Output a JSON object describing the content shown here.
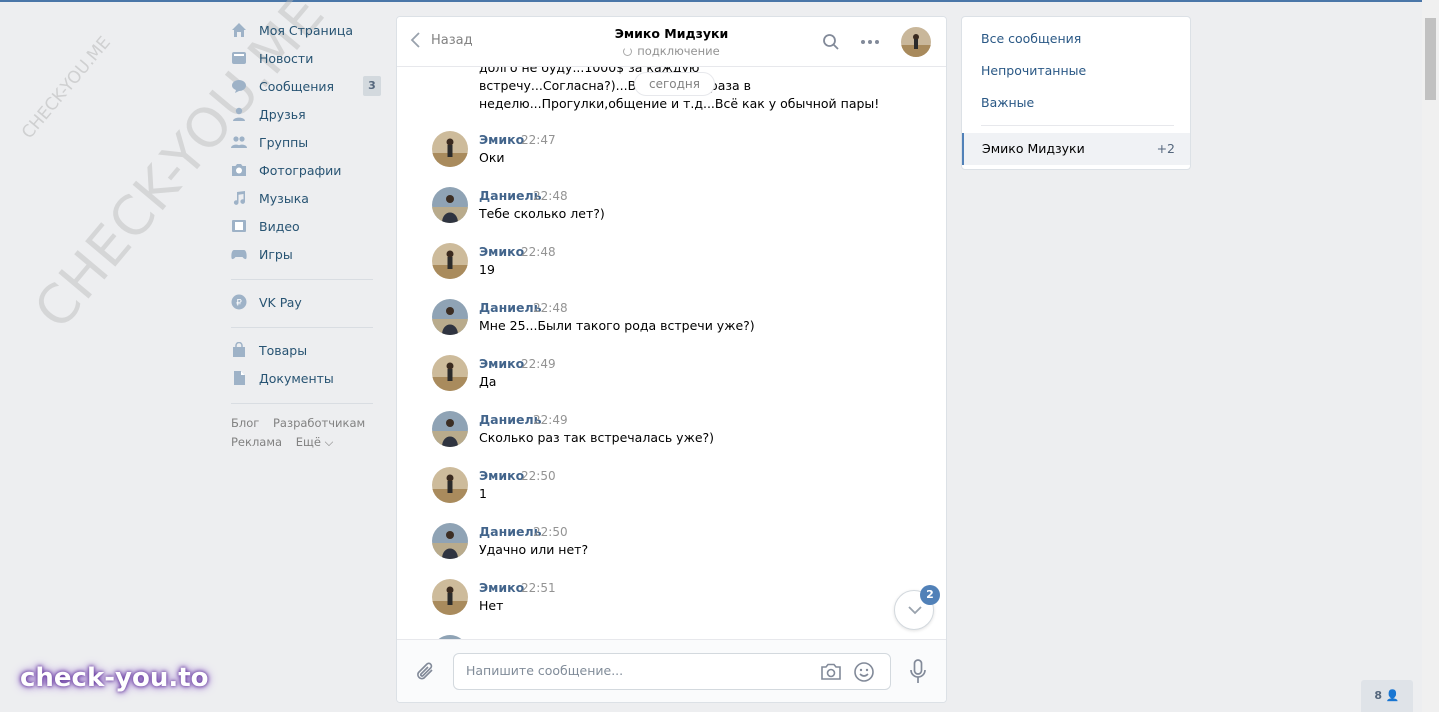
{
  "nav": {
    "items": [
      {
        "label": "Моя Страница",
        "icon": "home-icon"
      },
      {
        "label": "Новости",
        "icon": "news-icon"
      },
      {
        "label": "Сообщения",
        "icon": "messages-icon",
        "badge": "3"
      },
      {
        "label": "Друзья",
        "icon": "friends-icon"
      },
      {
        "label": "Группы",
        "icon": "groups-icon"
      },
      {
        "label": "Фотографии",
        "icon": "photos-icon"
      },
      {
        "label": "Музыка",
        "icon": "music-icon"
      },
      {
        "label": "Видео",
        "icon": "video-icon"
      },
      {
        "label": "Игры",
        "icon": "games-icon"
      },
      {
        "label": "VK Pay",
        "icon": "vkpay-icon"
      },
      {
        "label": "Товары",
        "icon": "market-icon"
      },
      {
        "label": "Документы",
        "icon": "documents-icon"
      }
    ],
    "footer": {
      "blog": "Блог",
      "dev": "Разработчикам",
      "ads": "Реклама",
      "more": "Ещё ⌵"
    }
  },
  "watermarks": {
    "small": "CHECK-YOU.ME",
    "large": "CHECK-YOU.ME",
    "brand": "check-you.to"
  },
  "chat": {
    "back_label": "Назад",
    "title": "Эмико Мидзуки",
    "status": "подключение",
    "date_pill": "сегодня",
    "prev_text": "долго не буду...1000$ за каждую встречу...Согласна?)...Встречи 2-3 раза в неделю...Прогулки,общение и т.д...Всё как у обычной пары!",
    "messages": [
      {
        "author": "Эмико",
        "time": "22:47",
        "text": "Оки"
      },
      {
        "author": "Даниель",
        "time": "22:48",
        "text": "Тебе сколько лет?)"
      },
      {
        "author": "Эмико",
        "time": "22:48",
        "text": "19"
      },
      {
        "author": "Даниель",
        "time": "22:48",
        "text": "Мне 25...Были такого рода встречи уже?)"
      },
      {
        "author": "Эмико",
        "time": "22:49",
        "text": "Да"
      },
      {
        "author": "Даниель",
        "time": "22:49",
        "text": "Сколько раз так встречалась уже?)"
      },
      {
        "author": "Эмико",
        "time": "22:50",
        "text": "1"
      },
      {
        "author": "Даниель",
        "time": "22:50",
        "text": "Удачно или нет?"
      },
      {
        "author": "Эмико",
        "time": "22:51",
        "text": "Нет"
      }
    ],
    "unread_badge": "2",
    "composer": {
      "placeholder": "Напишите сообщение..."
    }
  },
  "right_panel": {
    "all": "Все сообщения",
    "unread": "Непрочитанные",
    "important": "Важные",
    "active_dialog": "Эмико Мидзуки",
    "active_count": "+2"
  },
  "online_widget": "8",
  "colors": {
    "accent": "#5181b8",
    "link": "#2a5885",
    "author": "#42648b",
    "background": "#edeef0"
  }
}
